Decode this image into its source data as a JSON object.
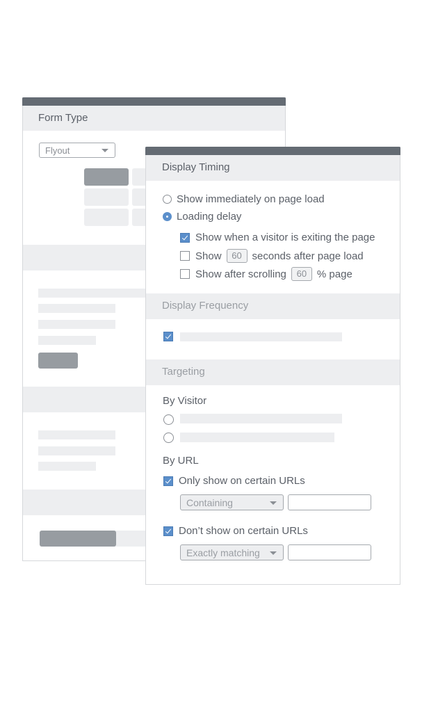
{
  "back_card": {
    "title": "Form Type",
    "form_type_select": {
      "value": "Flyout",
      "icon": "caret-down-icon"
    }
  },
  "front_card": {
    "display_timing": {
      "title": "Display Timing",
      "options": [
        {
          "label": "Show immediately on page load",
          "selected": false
        },
        {
          "label": "Loading delay",
          "selected": true
        }
      ],
      "delay_options": {
        "exit_intent": {
          "label": "Show when a visitor is exiting the page",
          "checked": true
        },
        "seconds": {
          "prefix": "Show",
          "value": "60",
          "suffix": "seconds after page load",
          "checked": false
        },
        "scroll": {
          "prefix": "Show after scrolling",
          "value": "60",
          "suffix": "% page",
          "checked": false
        }
      }
    },
    "display_frequency": {
      "title": "Display Frequency",
      "option_checked": true
    },
    "targeting": {
      "title": "Targeting",
      "by_visitor": {
        "label": "By Visitor"
      },
      "by_url": {
        "label": "By URL",
        "only_show": {
          "label": "Only show on certain URLs",
          "checked": true,
          "match_select": "Containing",
          "url_value": ""
        },
        "dont_show": {
          "label": "Don’t show on certain URLs",
          "checked": true,
          "match_select": "Exactly matching",
          "url_value": ""
        }
      }
    }
  },
  "colors": {
    "header_bar": "#646b73",
    "section_bg": "#edeef0",
    "accent": "#5b8fcb",
    "text": "#5b6068",
    "muted_text": "#9a9ea3"
  }
}
